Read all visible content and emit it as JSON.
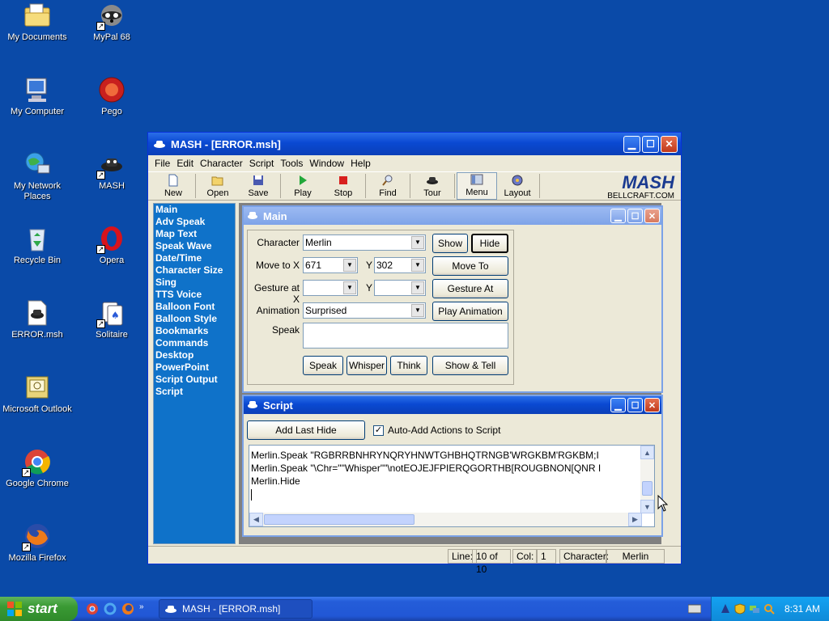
{
  "desktop": {
    "icons": [
      {
        "label": "My Documents",
        "icon": "folder-documents-icon"
      },
      {
        "label": "MyPal 68",
        "icon": "raccoon-icon"
      },
      {
        "label": "My Computer",
        "icon": "computer-icon"
      },
      {
        "label": "Pego",
        "icon": "pego-icon"
      },
      {
        "label": "My Network Places",
        "icon": "network-icon"
      },
      {
        "label": "MASH",
        "icon": "mash-icon"
      },
      {
        "label": "Recycle Bin",
        "icon": "recycle-bin-icon"
      },
      {
        "label": "Opera",
        "icon": "opera-icon"
      },
      {
        "label": "ERROR.msh",
        "icon": "msh-file-icon"
      },
      {
        "label": "Solitaire",
        "icon": "solitaire-icon"
      },
      {
        "label": "Microsoft Outlook",
        "icon": "outlook-icon"
      },
      {
        "label": "Google Chrome",
        "icon": "chrome-icon"
      },
      {
        "label": "Mozilla Firefox",
        "icon": "firefox-icon"
      }
    ]
  },
  "window": {
    "title": "MASH - [ERROR.msh]",
    "menu": [
      "File",
      "Edit",
      "Character",
      "Script",
      "Tools",
      "Window",
      "Help"
    ],
    "toolbar": [
      "New",
      "Open",
      "Save",
      "Play",
      "Stop",
      "Find",
      "Tour",
      "Menu",
      "Layout"
    ],
    "logo": {
      "name": "MASH",
      "site": "BELLCRAFT.COM"
    },
    "nav": [
      "Main",
      "Adv Speak",
      "Map Text",
      "Speak Wave",
      "Date/Time",
      "Character Size",
      "Sing",
      "TTS Voice",
      "Balloon Font",
      "Balloon Style",
      "Bookmarks",
      "Commands",
      "Desktop",
      "PowerPoint",
      "Script Output",
      "Script"
    ]
  },
  "main_child": {
    "title": "Main",
    "labels": {
      "character": "Character",
      "move_to_x": "Move to X",
      "y": "Y",
      "gesture_at_x": "Gesture at X",
      "animation": "Animation",
      "speak": "Speak"
    },
    "values": {
      "character": "Merlin",
      "move_x": "671",
      "move_y": "302",
      "gesture_x": "",
      "gesture_y": "",
      "animation": "Surprised",
      "speak_text": ""
    },
    "buttons": {
      "show": "Show",
      "hide": "Hide",
      "move_to": "Move To",
      "gesture_at": "Gesture At",
      "play_animation": "Play Animation",
      "speak": "Speak",
      "whisper": "Whisper",
      "think": "Think",
      "show_tell": "Show & Tell"
    }
  },
  "script_child": {
    "title": "Script",
    "add_last": "Add Last Hide",
    "auto_add": "Auto-Add Actions to Script",
    "lines": [
      "Merlin.Speak \"RGBRRBNHRYNQRYHNWTGHBHQTRNGB'WRGKBM'RGKBM;I",
      "Merlin.Speak \"\\Chr=\"\"Whisper\"\"\\notEOJEJFPIERQGORTHB[ROUGBNON[QNR I",
      "Merlin.Hide"
    ]
  },
  "status": {
    "line_label": "Line:",
    "line_value": "10 of 10",
    "col_label": "Col:",
    "col_value": "1",
    "char_label": "Character:",
    "char_value": "Merlin"
  },
  "taskbar": {
    "start": "start",
    "task": "MASH - [ERROR.msh]",
    "clock": "8:31 AM"
  }
}
